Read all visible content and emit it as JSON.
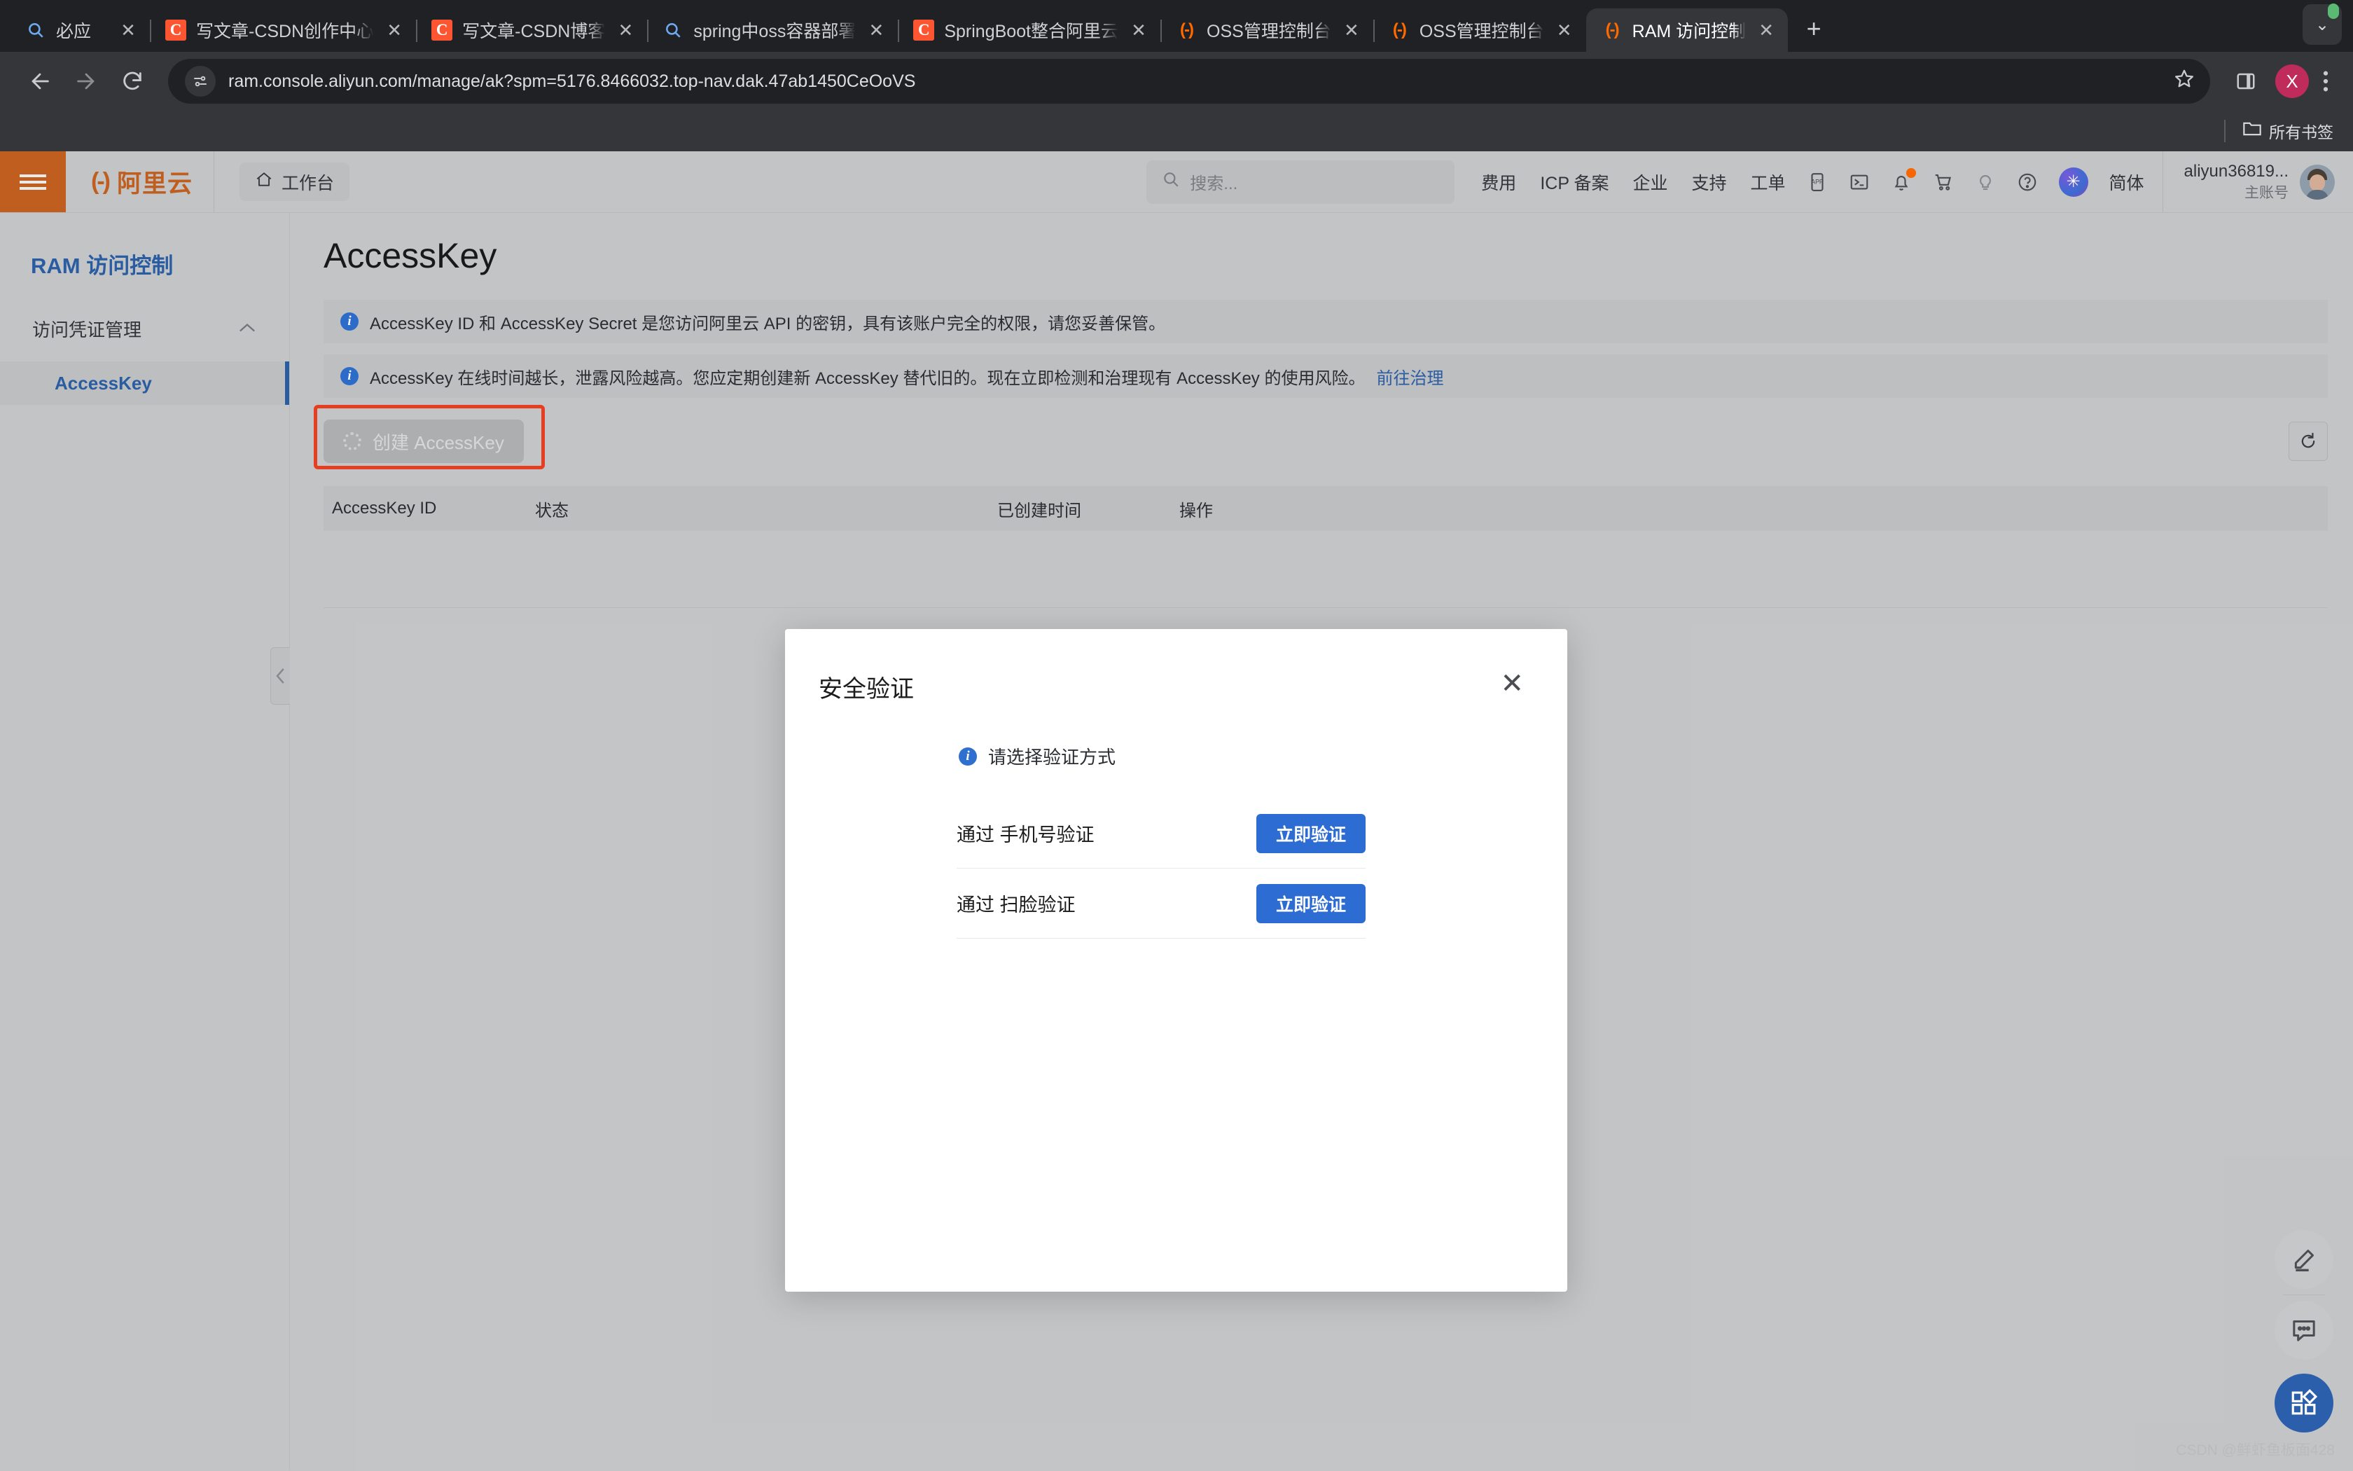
{
  "browser": {
    "tabs": [
      {
        "title": "必应",
        "favicon": "search-icon",
        "active": false
      },
      {
        "title": "写文章-CSDN创作中心",
        "favicon": "csdn-icon",
        "active": false
      },
      {
        "title": "写文章-CSDN博客",
        "favicon": "csdn-icon",
        "active": false
      },
      {
        "title": "spring中oss容器部署",
        "favicon": "search-icon",
        "active": false
      },
      {
        "title": "SpringBoot整合阿里云",
        "favicon": "csdn-icon",
        "active": false
      },
      {
        "title": "OSS管理控制台",
        "favicon": "aliyun-icon",
        "active": false
      },
      {
        "title": "OSS管理控制台",
        "favicon": "aliyun-icon",
        "active": false
      },
      {
        "title": "RAM 访问控制",
        "favicon": "aliyun-icon",
        "active": true
      }
    ],
    "new_tab_label": "+",
    "tab_list_chevron": "⌄",
    "nav": {
      "back": "←",
      "forward": "→",
      "reload": "⟳"
    },
    "omnibox": {
      "url": "ram.console.aliyun.com/manage/ak?spm=5176.8466032.top-nav.dak.47ab1450CeOoVS",
      "site_info_icon": "site-settings-icon",
      "bookmark_icon": "star-icon"
    },
    "side_panel_icon": "side-panel-icon",
    "profile_initial": "X",
    "menu_icon": "kebab-menu-icon",
    "bookmarks": {
      "all_bookmarks_label": "所有书签",
      "folder_icon": "folder-icon"
    }
  },
  "console": {
    "header": {
      "menu_icon": "hamburger-icon",
      "logo_text": "阿里云",
      "workbench_label": "工作台",
      "home_icon": "home-icon",
      "search_placeholder": "搜索...",
      "search_icon": "search-icon",
      "nav_items": [
        "费用",
        "ICP 备案",
        "企业",
        "支持",
        "工单"
      ],
      "icons": [
        "app-icon",
        "terminal-icon",
        "bell-icon",
        "cart-icon",
        "bulb-icon",
        "help-icon",
        "ai-assistant-icon"
      ],
      "language_label": "简体",
      "user_name": "aliyun36819...",
      "user_role": "主账号"
    },
    "sidebar": {
      "title": "RAM 访问控制",
      "group_label": "访问凭证管理",
      "group_chevron": "⌃",
      "items": [
        {
          "label": "AccessKey",
          "active": true
        }
      ],
      "collapse_icon": "chevron-left-icon"
    },
    "main": {
      "page_title": "AccessKey",
      "alerts": [
        {
          "icon": "info-icon",
          "text": "AccessKey ID 和 AccessKey Secret 是您访问阿里云 API 的密钥，具有该账户完全的权限，请您妥善保管。",
          "link": ""
        },
        {
          "icon": "info-icon",
          "text": "AccessKey 在线时间越长，泄露风险越高。您应定期创建新 AccessKey 替代旧的。现在立即检测和治理现有 AccessKey 的使用风险。",
          "link": "前往治理"
        }
      ],
      "create_button": {
        "label": "创建 AccessKey",
        "loading_icon": "spinner-icon",
        "disabled": true
      },
      "refresh_icon": "refresh-icon",
      "table": {
        "columns": [
          "AccessKey ID",
          "状态",
          "已创建时间",
          "操作"
        ],
        "rows": []
      }
    },
    "modal": {
      "title": "安全验证",
      "close_icon": "close-icon",
      "hint_icon": "info-icon",
      "hint": "请选择验证方式",
      "options": [
        {
          "label": "通过 手机号验证",
          "button": "立即验证"
        },
        {
          "label": "通过 扫脸验证",
          "button": "立即验证"
        }
      ]
    },
    "rail": [
      {
        "icon": "pencil-icon",
        "primary": false
      },
      {
        "icon": "feedback-icon",
        "primary": false
      },
      {
        "icon": "apps-grid-icon",
        "primary": true
      }
    ],
    "watermark": "CSDN @鲜虾鱼板面428"
  },
  "colors": {
    "accent_orange": "#c6621f",
    "link_blue": "#2c5fa8",
    "primary_blue": "#2d6cd2",
    "highlight_red": "#ef4123"
  }
}
